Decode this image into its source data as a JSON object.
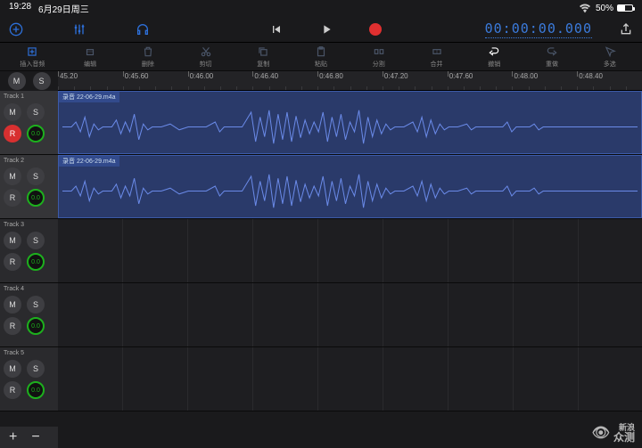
{
  "status": {
    "time": "19:28",
    "date": "6月29日周三",
    "battery_pct": "50%"
  },
  "transport": {
    "timecode": "00:00:00.000"
  },
  "toolbar2": {
    "items": [
      {
        "label": "插入音频"
      },
      {
        "label": "编辑"
      },
      {
        "label": "删除"
      },
      {
        "label": "剪切"
      },
      {
        "label": "复制"
      },
      {
        "label": "粘贴"
      },
      {
        "label": "分割"
      },
      {
        "label": "合并"
      },
      {
        "label": "撤销"
      },
      {
        "label": "重做"
      },
      {
        "label": "多选"
      }
    ]
  },
  "ruler": {
    "ticks": [
      "45.20",
      "0:45.60",
      "0:46.00",
      "0:46.40",
      "0:46.80",
      "0:47.20",
      "0:47.60",
      "0:48.00",
      "0:48.40"
    ]
  },
  "tracks": [
    {
      "name": "Track 1",
      "m": "M",
      "s": "S",
      "r": "R",
      "meter": "0.0",
      "clip": "录音 22-06-29.m4a",
      "hasWave": true,
      "expanded": true
    },
    {
      "name": "Track 2",
      "m": "M",
      "s": "S",
      "r": "R",
      "meter": "0.0",
      "clip": "录音 22-06-29.m4a",
      "hasWave": true,
      "expanded": true
    },
    {
      "name": "Track 3",
      "m": "M",
      "s": "S",
      "r": "R",
      "meter": "0.0",
      "hasWave": false,
      "expanded": false
    },
    {
      "name": "Track 4",
      "m": "M",
      "s": "S",
      "r": "R",
      "meter": "0.0",
      "hasWave": false,
      "expanded": false
    },
    {
      "name": "Track 5",
      "m": "M",
      "s": "S",
      "r": "R",
      "meter": "0.0",
      "hasWave": false,
      "expanded": false
    }
  ],
  "bottom": {
    "plus": "+",
    "minus": "−"
  },
  "watermark": {
    "brand": "新浪",
    "sub": "众测"
  }
}
